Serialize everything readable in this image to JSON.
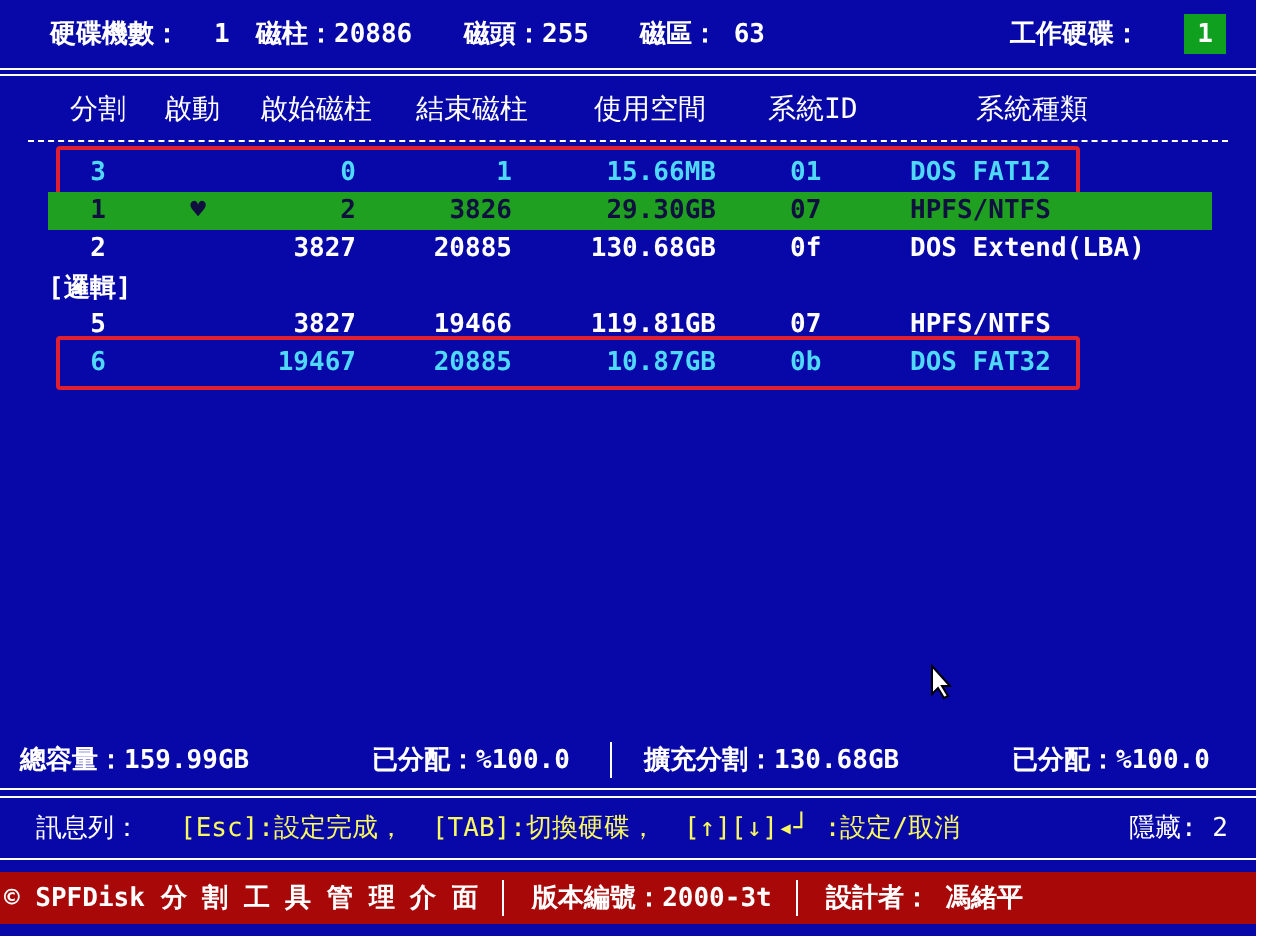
{
  "disk_info": {
    "disk_count_label": "硬碟機數：",
    "disk_count": "1",
    "cylinders": "磁柱：20886",
    "heads": "磁頭：255",
    "sectors": "磁區： 63",
    "work_disk_label": "工作硬碟：",
    "work_disk": "1"
  },
  "table": {
    "columns": [
      "分割",
      "啟動",
      "啟始磁柱",
      "結束磁柱",
      "使用空間",
      "系統ID",
      "系統種類"
    ],
    "rows": [
      {
        "kind": "partition",
        "number": "3",
        "boot": "",
        "start": "0",
        "end": "1",
        "size": "15.66MB",
        "id": "01",
        "type": "DOS FAT12",
        "selected": false,
        "hidden": true,
        "marked": true
      },
      {
        "kind": "partition",
        "number": "1",
        "boot": "♥",
        "start": "2",
        "end": "3826",
        "size": "29.30GB",
        "id": "07",
        "type": "HPFS/NTFS",
        "selected": true,
        "hidden": false,
        "marked": false
      },
      {
        "kind": "partition",
        "number": "2",
        "boot": "",
        "start": "3827",
        "end": "20885",
        "size": "130.68GB",
        "id": "0f",
        "type": "DOS Extend(LBA)",
        "selected": false,
        "hidden": false,
        "marked": false
      },
      {
        "kind": "group",
        "label": "[邏輯]"
      },
      {
        "kind": "partition",
        "number": "5",
        "boot": "",
        "start": "3827",
        "end": "19466",
        "size": "119.81GB",
        "id": "07",
        "type": "HPFS/NTFS",
        "selected": false,
        "hidden": false,
        "marked": false
      },
      {
        "kind": "partition",
        "number": "6",
        "boot": "",
        "start": "19467",
        "end": "20885",
        "size": "10.87GB",
        "id": "0b",
        "type": "DOS FAT32",
        "selected": false,
        "hidden": true,
        "marked": true
      }
    ]
  },
  "summary": [
    "總容量：159.99GB",
    "已分配：%100.0",
    "擴充分割：130.68GB",
    "已分配：%100.0"
  ],
  "message_bar": {
    "label": "訊息列：",
    "hints": [
      "[Esc]:設定完成，",
      "[TAB]:切換硬碟，",
      "[↑][↓]◂┘ :設定/取消"
    ],
    "hidden_count": "隱藏: 2"
  },
  "footer": [
    "© SPFDisk 分 割 工 具 管 理 介 面",
    "版本編號：2000-3t",
    "設計者： 馮緒平"
  ]
}
